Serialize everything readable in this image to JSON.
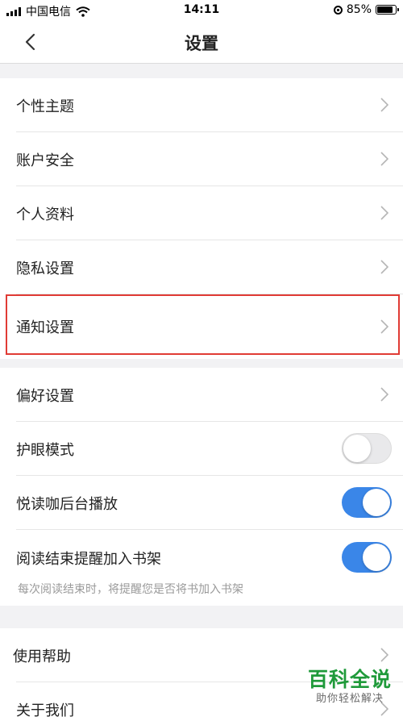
{
  "status_bar": {
    "carrier": "中国电信",
    "time": "14:11",
    "battery": "85%",
    "battery_level": 0.85
  },
  "nav": {
    "title": "设置",
    "back_icon": "chevron-left-icon"
  },
  "group1": {
    "items": [
      {
        "label": "个性主题"
      },
      {
        "label": "账户安全"
      },
      {
        "label": "个人资料"
      },
      {
        "label": "隐私设置"
      },
      {
        "label": "通知设置",
        "highlighted": true
      }
    ]
  },
  "group2": {
    "items": [
      {
        "label": "偏好设置"
      },
      {
        "label": "护眼模式",
        "toggle": false
      },
      {
        "label": "悦读咖后台播放",
        "toggle": true
      },
      {
        "label": "阅读结束提醒加入书架",
        "toggle": true,
        "description": "每次阅读结束时，将提醒您是否将书加入书架"
      }
    ]
  },
  "group3": {
    "items": [
      {
        "label": "使用帮助"
      },
      {
        "label": "关于我们"
      }
    ]
  },
  "watermark": {
    "title": "百科全说",
    "subtitle": "助你轻松解决"
  },
  "colors": {
    "toggle_on": "#3a86e8",
    "highlight": "#e03b35",
    "watermark": "#1f9a3a"
  }
}
